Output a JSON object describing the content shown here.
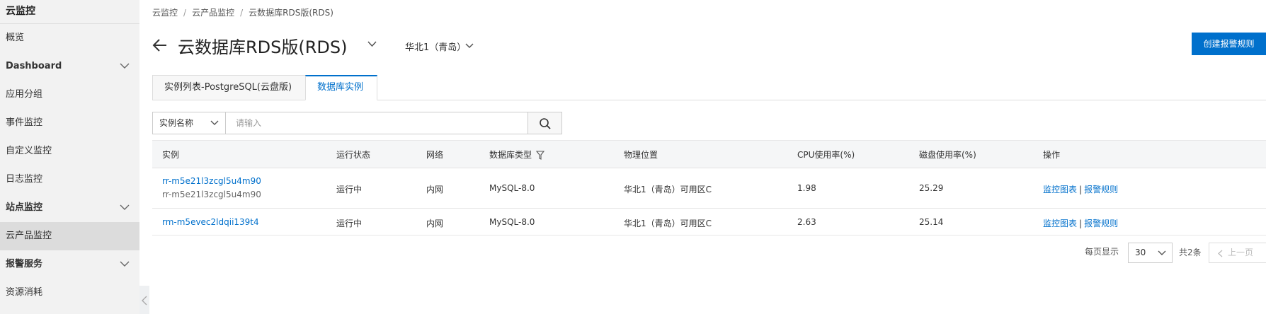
{
  "sidebar": {
    "title": "云监控",
    "items": [
      {
        "label": "概览"
      },
      {
        "label": "Dashboard"
      },
      {
        "label": "应用分组"
      },
      {
        "label": "事件监控"
      },
      {
        "label": "自定义监控"
      },
      {
        "label": "日志监控"
      },
      {
        "label": "站点监控"
      },
      {
        "label": "云产品监控"
      },
      {
        "label": "报警服务"
      },
      {
        "label": "资源消耗"
      }
    ]
  },
  "breadcrumb": {
    "items": [
      "云监控",
      "云产品监控",
      "云数据库RDS版(RDS)"
    ],
    "separator": "/"
  },
  "header": {
    "title": "云数据库RDS版(RDS)",
    "region": "华北1（青岛）",
    "create_alarm_label": "创建报警规则"
  },
  "tabs": [
    {
      "label": "实例列表-PostgreSQL(云盘版)",
      "active": false
    },
    {
      "label": "数据库实例",
      "active": true
    }
  ],
  "search": {
    "type_label": "实例名称",
    "placeholder": "请输入"
  },
  "table": {
    "columns": [
      "实例",
      "运行状态",
      "网络",
      "数据库类型",
      "物理位置",
      "CPU使用率(%)",
      "磁盘使用率(%)",
      "操作"
    ],
    "rows": [
      {
        "instance_id": "rr-m5e21l3zcgl5u4m90",
        "instance_name": "rr-m5e21l3zcgl5u4m90",
        "status": "运行中",
        "network": "内网",
        "db_type": "MySQL-8.0",
        "location": "华北1（青岛）可用区C",
        "cpu": "1.98",
        "disk": "25.29",
        "action_chart": "监控图表",
        "action_alarm": "报警规则"
      },
      {
        "instance_id": "rm-m5evec2ldqii139t4",
        "status": "运行中",
        "network": "内网",
        "db_type": "MySQL-8.0",
        "location": "华北1（青岛）可用区C",
        "cpu": "2.63",
        "disk": "25.14",
        "action_chart": "监控图表",
        "action_alarm": "报警规则"
      }
    ]
  },
  "pagination": {
    "per_page_label": "每页显示",
    "per_page_value": "30",
    "total_label": "共2条",
    "prev_label": "上一页"
  },
  "colors": {
    "accent": "#0070cc",
    "sidebar_bg": "#f2f2f2",
    "sidebar_active": "#dcdcdc"
  }
}
